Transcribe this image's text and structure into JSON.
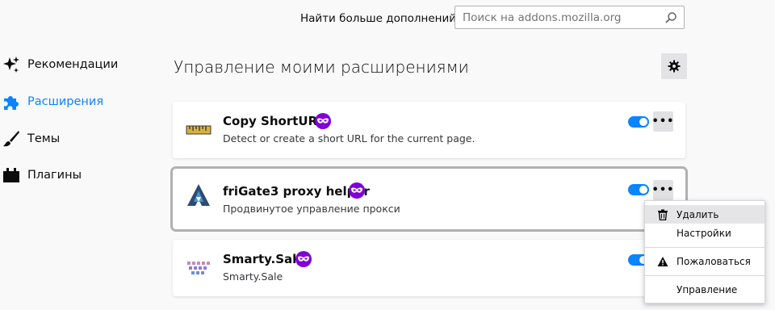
{
  "header": {
    "find_more_label": "Найти больше дополнений",
    "search_placeholder": "Поиск на addons.mozilla.org"
  },
  "sidebar": {
    "items": [
      {
        "label": "Рекомендации",
        "icon": "sparkle-icon",
        "active": false
      },
      {
        "label": "Расширения",
        "icon": "puzzle-icon",
        "active": true
      },
      {
        "label": "Темы",
        "icon": "brush-icon",
        "active": false
      },
      {
        "label": "Плагины",
        "icon": "plugin-block-icon",
        "active": false
      }
    ]
  },
  "main": {
    "title": "Управление моими расширениями",
    "extensions": [
      {
        "name": "Copy ShortURL",
        "description": "Detect or create a short URL for the current page.",
        "enabled": true,
        "private_badge": true
      },
      {
        "name": "friGate3 proxy helper",
        "description": "Продвинутое управление прокси",
        "enabled": true,
        "private_badge": true
      },
      {
        "name": "Smarty.Sale",
        "description": "Smarty.Sale",
        "enabled": true,
        "private_badge": true
      }
    ]
  },
  "context_menu": {
    "items": [
      {
        "label": "Удалить",
        "icon": "trash-icon"
      },
      {
        "label": "Настройки",
        "icon": ""
      },
      {
        "label": "Пожаловаться",
        "icon": "warning-icon"
      },
      {
        "label": "Управление",
        "icon": ""
      }
    ]
  },
  "colors": {
    "accent": "#0a84ff",
    "private_badge": "#8000d7"
  }
}
